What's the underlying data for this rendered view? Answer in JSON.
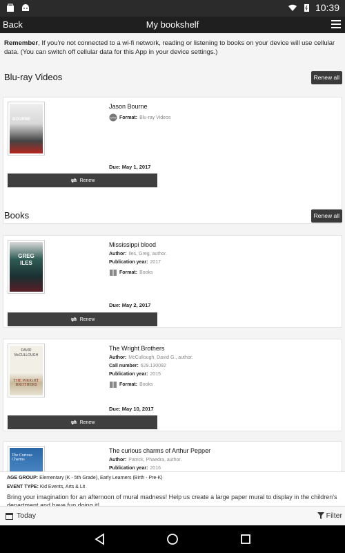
{
  "status_bar": {
    "time": "10:39"
  },
  "app_bar": {
    "back_label": "Back",
    "title": "My bookshelf"
  },
  "notice": {
    "bold": "Remember",
    "text": ", If you're not connected to a wi-fi network, reading or listening to books on your device will use cellular data. (You can switch off cellular data for this App in your device settings.)"
  },
  "sections": [
    {
      "title": "Blu-ray Videos",
      "renew_all": "Renew all"
    },
    {
      "title": "Books",
      "renew_all": "Renew all"
    }
  ],
  "items": [
    {
      "title": "Jason Bourne",
      "format_label": "Format:",
      "format_value": "Blu-ray Videos",
      "due": "Due: May 1, 2017",
      "renew": "Renew",
      "cover_text": "BOURNE"
    },
    {
      "title": "Mississippi blood",
      "author_label": "Author:",
      "author_value": "Iles, Greg, author.",
      "year_label": "Publication year:",
      "year_value": "2017",
      "format_label": "Format:",
      "format_value": "Books",
      "due": "Due: May 2, 2017",
      "renew": "Renew",
      "cover_text_top": "GREG",
      "cover_text_bottom": "ILES"
    },
    {
      "title": "The Wright Brothers",
      "author_label": "Author:",
      "author_value": "McCullough, David G., author.",
      "call_label": "Call number:",
      "call_value": "629.130092",
      "year_label": "Publication year:",
      "year_value": "2015",
      "format_label": "Format:",
      "format_value": "Books",
      "due": "Due: May 10, 2017",
      "renew": "Renew",
      "cover_text_top": "DAVID",
      "cover_text_bottom": "McCULLOUGH",
      "cover_text_title": "THE WRIGHT BROTHERS"
    },
    {
      "title": "The curious charms of Arthur Pepper",
      "author_label": "Author:",
      "author_value": "Patrick, Phaedra, author.",
      "year_label": "Publication year:",
      "year_value": "2016",
      "cover_text": "The Curious Charms"
    }
  ],
  "event": {
    "age_label": "AGE GROUP:",
    "age_value": "Elementary (K - 5th Grade), Early Learners (Birth - Pre-K)",
    "type_label": "EVENT TYPE:",
    "type_value": "Kid Events, Arts & Lit",
    "description": "Bring your imagination for an afternoon of mural madness! Help us create a large paper mural to display in the children's department and have fun doing it!"
  },
  "bottom_bar": {
    "today_label": "Today",
    "filter_label": "Filter"
  },
  "colors": {
    "dark_bar": "#1f1f1f",
    "button": "#3f3f3f",
    "meta_value": "#888888"
  }
}
